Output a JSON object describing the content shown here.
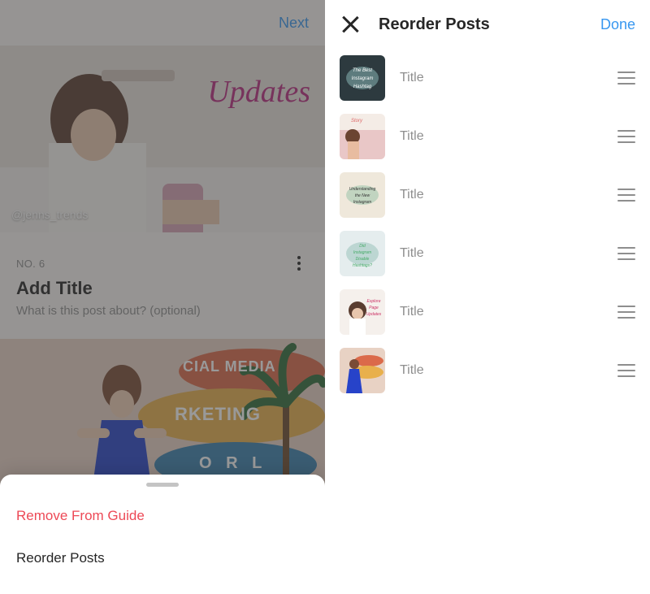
{
  "left": {
    "next_label": "Next",
    "hero_badge": "Updates",
    "hero_tag": "@jenns_trends",
    "post_number": "NO. 6",
    "title_placeholder": "Add Title",
    "subtitle_placeholder": "What is this post about? (optional)",
    "mural_line1": "CIAL MEDIA",
    "mural_line2": "RKETING",
    "mural_line3": "O R L"
  },
  "sheet": {
    "remove_label": "Remove From Guide",
    "reorder_label": "Reorder Posts"
  },
  "right": {
    "title": "Reorder Posts",
    "done_label": "Done",
    "items": [
      {
        "label": "Title"
      },
      {
        "label": "Title"
      },
      {
        "label": "Title"
      },
      {
        "label": "Title"
      },
      {
        "label": "Title"
      },
      {
        "label": "Title"
      }
    ]
  }
}
